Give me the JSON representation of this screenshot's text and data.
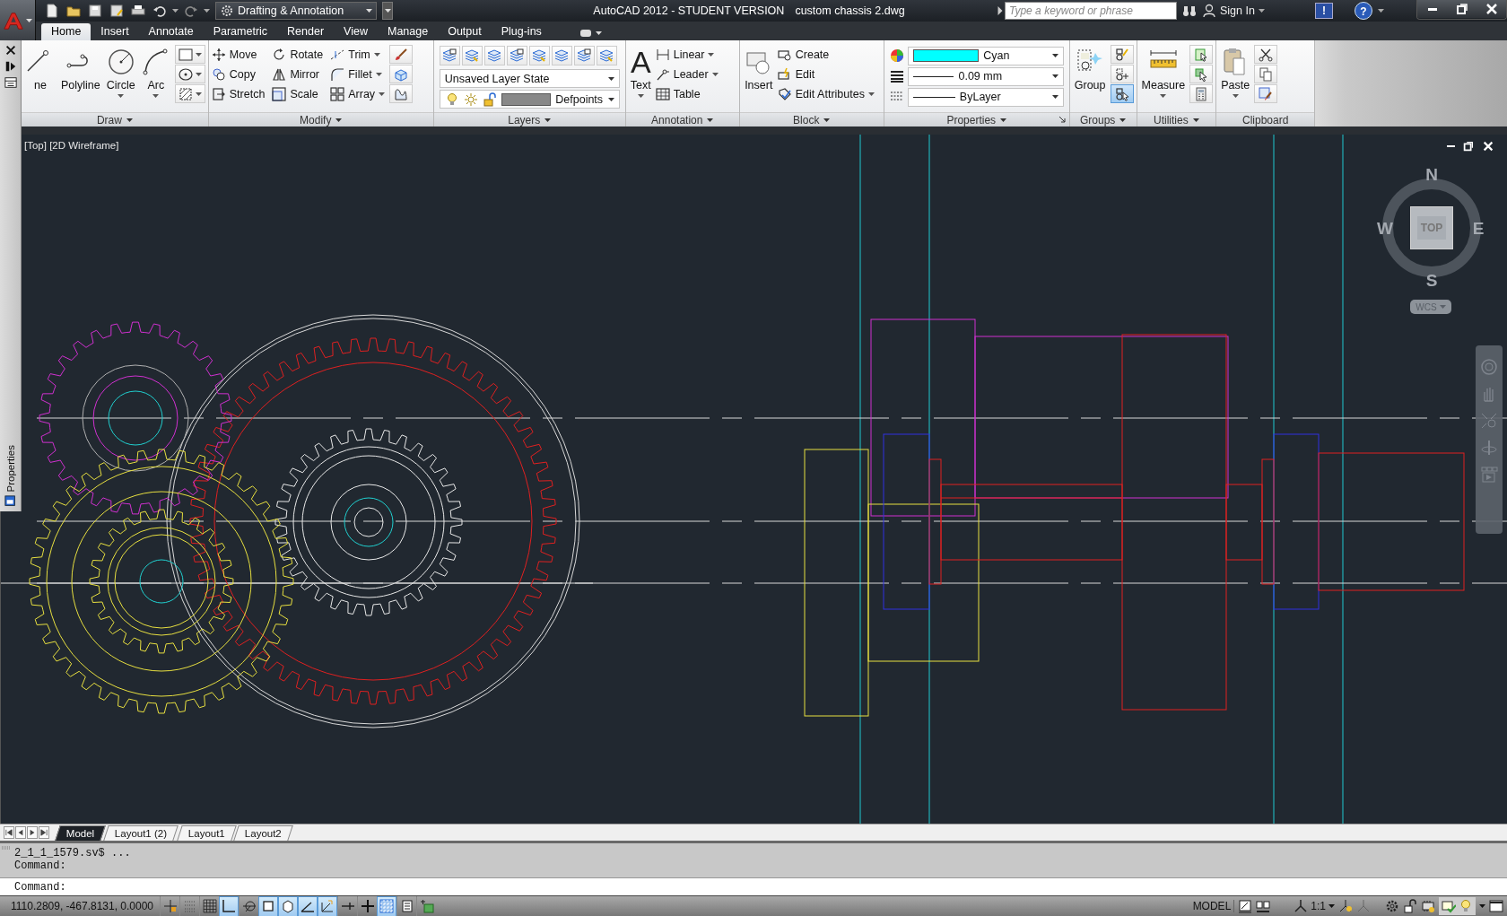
{
  "title_bar": {
    "workspace": "Drafting & Annotation",
    "app_title": "AutoCAD 2012 - STUDENT VERSION",
    "file_name": "custom chassis 2.dwg",
    "search": {
      "placeholder": "Type a keyword or phrase"
    },
    "sign_in": "Sign In",
    "exchange": "!",
    "help": "?"
  },
  "ribbon_tabs": [
    {
      "label": "Home",
      "selected": true
    },
    {
      "label": "Insert",
      "selected": false
    },
    {
      "label": "Annotate",
      "selected": false
    },
    {
      "label": "Parametric",
      "selected": false
    },
    {
      "label": "Render",
      "selected": false
    },
    {
      "label": "View",
      "selected": false
    },
    {
      "label": "Manage",
      "selected": false
    },
    {
      "label": "Output",
      "selected": false
    },
    {
      "label": "Plug-ins",
      "selected": false
    }
  ],
  "ribbon": {
    "panels": [
      {
        "title": "Draw",
        "kind": "tools",
        "menu": true,
        "large": [
          {
            "label": "ne",
            "menu": false
          },
          {
            "label": "Polyline",
            "menu": false
          },
          {
            "label": "Circle",
            "menu": true
          },
          {
            "label": "Arc",
            "menu": true
          }
        ]
      },
      {
        "title": "Modify",
        "kind": "tools",
        "menu": true,
        "small": [
          {
            "label": "Move",
            "menu": false
          },
          {
            "label": "Rotate",
            "menu": false
          },
          {
            "label": "Trim",
            "menu": true
          },
          {
            "label": "Copy",
            "menu": false
          },
          {
            "label": "Mirror",
            "menu": false
          },
          {
            "label": "Fillet",
            "menu": true
          },
          {
            "label": "Stretch",
            "menu": false
          },
          {
            "label": "Scale",
            "menu": false
          },
          {
            "label": "Array",
            "menu": true
          }
        ]
      },
      {
        "title": "Layers",
        "kind": "layers",
        "menu": true,
        "selects": [
          {
            "value": "Unsaved Layer State"
          },
          {
            "value": "Defpoints"
          }
        ]
      },
      {
        "title": "Annotation",
        "kind": "tools",
        "menu": true,
        "large": [
          {
            "label": "Text",
            "glyph": "A",
            "menu": true
          }
        ],
        "small": [
          {
            "label": "Linear",
            "menu": true
          },
          {
            "label": "Leader",
            "menu": true
          },
          {
            "label": "Table",
            "menu": false
          }
        ]
      },
      {
        "title": "Block",
        "kind": "tools",
        "menu": true,
        "large": [
          {
            "label": "Insert",
            "menu": false
          }
        ],
        "small": [
          {
            "label": "Create",
            "menu": false
          },
          {
            "label": "Edit",
            "menu": false
          },
          {
            "label": "Edit Attributes",
            "menu": true
          }
        ]
      },
      {
        "title": "Properties",
        "kind": "properties",
        "menu": true,
        "selects": [
          {
            "value": "Cyan",
            "color": "#00ffff"
          },
          {
            "value": "0.09 mm"
          },
          {
            "value": "ByLayer"
          }
        ]
      },
      {
        "title": "Groups",
        "kind": "tools",
        "menu": true,
        "large": [
          {
            "label": "Group",
            "menu": false
          }
        ],
        "icon_tools": [
          {
            "on": false
          },
          {
            "on": false
          },
          {
            "on": true
          }
        ]
      },
      {
        "title": "Utilities",
        "kind": "tools",
        "menu": true,
        "large": [
          {
            "label": "Measure",
            "menu": true
          }
        ]
      },
      {
        "title": "Clipboard",
        "kind": "tools",
        "menu": false,
        "large": [
          {
            "label": "Paste",
            "menu": true
          }
        ]
      }
    ]
  },
  "palette": {
    "title": "Properties"
  },
  "viewport": {
    "label": "[Top] [2D Wireframe]",
    "compass": {
      "north": "N",
      "east": "E",
      "south": "S",
      "west": "W"
    },
    "face": "TOP",
    "ucs": "WCS"
  },
  "layout_tabs": [
    {
      "label": "Model",
      "selected": true
    },
    {
      "label": "Layout1 (2)",
      "selected": false
    },
    {
      "label": "Layout1",
      "selected": false
    },
    {
      "label": "Layout2",
      "selected": false
    }
  ],
  "command": {
    "history": [
      "2_1_1_1579.sv$ ...",
      "Command:"
    ],
    "prompt": "Command:"
  },
  "status_bar": {
    "coordinates": "1110.2809, -467.8131, 0.0000",
    "toggles": [
      {
        "on": false
      },
      {
        "on": false
      },
      {
        "on": false
      },
      {
        "on": true
      },
      {
        "on": false
      },
      {
        "on": true
      },
      {
        "on": true
      },
      {
        "on": true
      },
      {
        "on": true
      },
      {
        "on": false
      },
      {
        "on": false
      },
      {
        "on": true
      },
      {
        "on": false
      },
      {
        "on": false
      }
    ],
    "space": "MODEL",
    "annotation_scale": "1:1"
  }
}
